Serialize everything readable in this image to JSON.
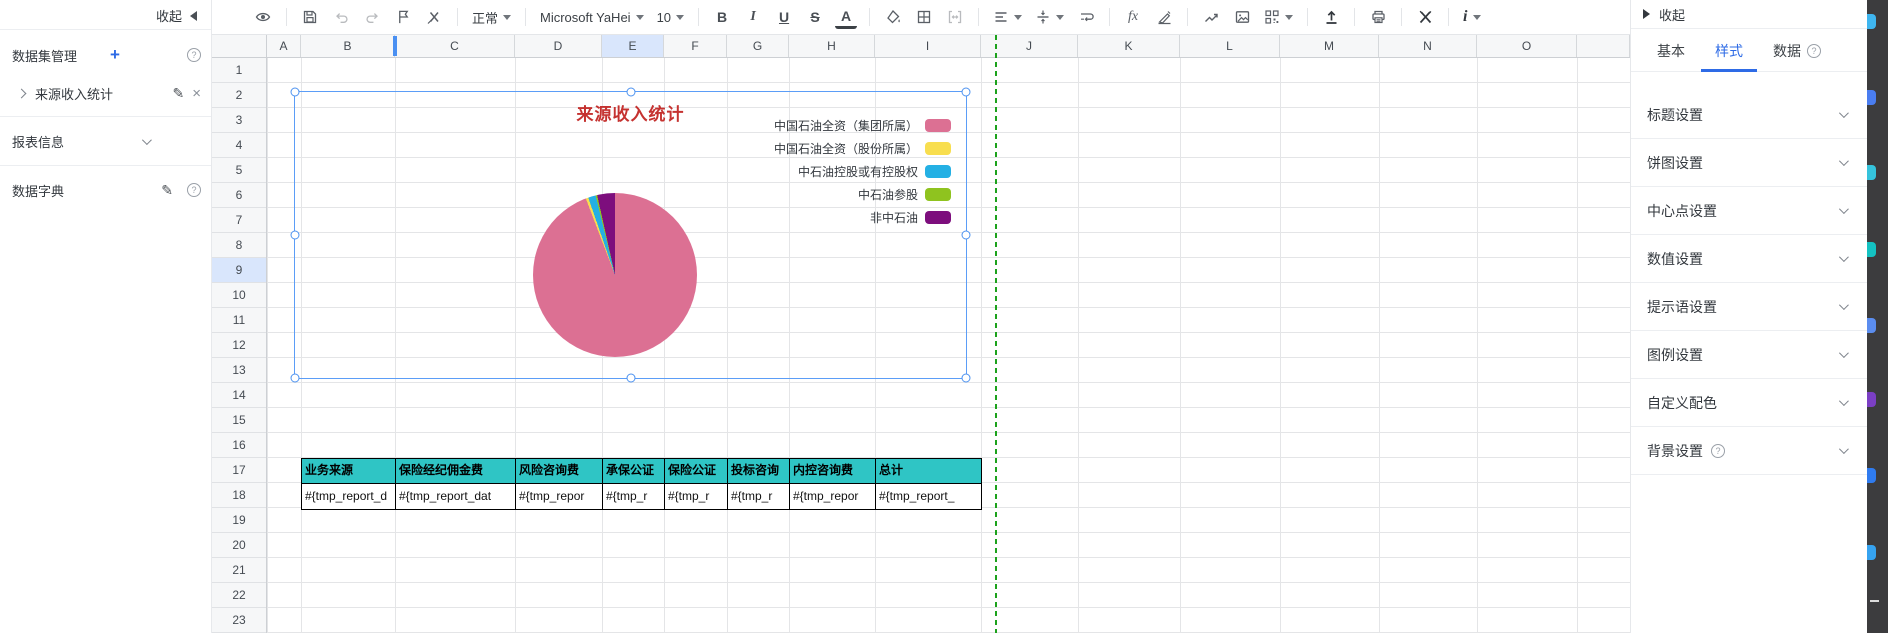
{
  "left_sidebar": {
    "collapse_label": "收起",
    "dataset_manage_label": "数据集管理",
    "dataset_item_label": "来源收入统计",
    "report_info_label": "报表信息",
    "data_dict_label": "数据字典"
  },
  "toolbar": {
    "style_value": "正常",
    "font_value": "Microsoft YaHei",
    "size_value": "10",
    "icons": [
      "preview-eye",
      "save",
      "undo",
      "redo",
      "format-painter",
      "clear-format",
      "bold",
      "italic",
      "underline",
      "strikethrough",
      "font-color",
      "fill-color",
      "cell-borders",
      "merge-cells",
      "align-horizontal",
      "align-vertical",
      "text-wrap",
      "formula-fx",
      "conditional-format",
      "insert-chart",
      "insert-image",
      "insert-qrcode",
      "upload",
      "print",
      "toolkit",
      "info"
    ]
  },
  "sheet": {
    "columns": [
      "A",
      "B",
      "C",
      "D",
      "E",
      "F",
      "G",
      "H",
      "I",
      "J",
      "K",
      "L",
      "M",
      "N",
      "O",
      ""
    ],
    "selected_column": "E",
    "rows": [
      "1",
      "2",
      "3",
      "4",
      "5",
      "6",
      "7",
      "8",
      "9",
      "10",
      "11",
      "12",
      "13",
      "14",
      "15",
      "16",
      "17",
      "18",
      "19",
      "20",
      "21",
      "22",
      "23"
    ],
    "selected_row": "9"
  },
  "chart_data": {
    "type": "pie",
    "title": "来源收入统计",
    "title_color": "#c53230",
    "labels": [
      "中国石油全资（集团所属）",
      "中国石油全资（股份所属）",
      "中石油控股或有控股权",
      "中石油参股",
      "非中石油"
    ],
    "values_pct": [
      94.2,
      0.5,
      1.5,
      0.3,
      3.5
    ],
    "colors": [
      "#dc7093",
      "#f8de4f",
      "#24b0e4",
      "#8fc31f",
      "#7d0e7d"
    ],
    "legend_position": "right"
  },
  "table": {
    "headers": [
      "业务来源",
      "保险经纪佣金费",
      "风险咨询费",
      "承保公证",
      "保险公证",
      "投标咨询",
      "内控咨询费",
      "总计"
    ],
    "values": [
      "#{tmp_report_d",
      "#{tmp_report_dat",
      "#{tmp_repor",
      "#{tmp_r",
      "#{tmp_r",
      "#{tmp_r",
      "#{tmp_repor",
      "#{tmp_report_"
    ],
    "header_bg": "#2fc5c5"
  },
  "right_panel": {
    "collapse_label": "收起",
    "tabs": [
      "基本",
      "样式",
      "数据"
    ],
    "active_tab": "样式",
    "sections": [
      "标题设置",
      "饼图设置",
      "中心点设置",
      "数值设置",
      "提示语设置",
      "图例设置",
      "自定义配色",
      "背景设置"
    ]
  }
}
